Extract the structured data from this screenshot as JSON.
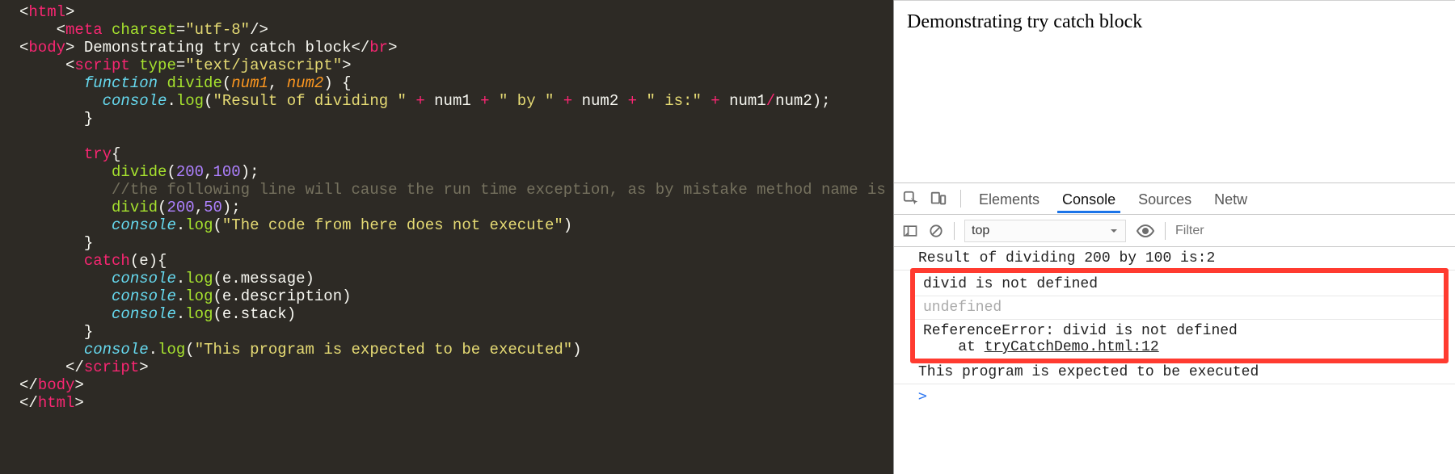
{
  "code": {
    "l1": {
      "a": "<",
      "b": "html",
      "c": ">"
    },
    "l2": {
      "a": "    <",
      "b": "meta",
      "sp": " ",
      "attr": "charset",
      "eq": "=",
      "str": "\"utf-8\"",
      "end": "/>"
    },
    "l3": {
      "a": "<",
      "b": "body",
      "c": "> Demonstrating try catch block</",
      "d": "br",
      "e": ">"
    },
    "l4": {
      "a": "     <",
      "b": "script",
      "sp": " ",
      "attr": "type",
      "eq": "=",
      "str": "\"text/javascript\"",
      "end": ">"
    },
    "l5": {
      "ind": "       ",
      "kw": "function",
      "sp": " ",
      "fn": "divide",
      "p1": "(",
      "a1": "num1",
      "cm": ", ",
      "a2": "num2",
      "p2": ") {"
    },
    "l6": {
      "ind": "         ",
      "obj": "console",
      "dot": ".",
      "m": "log",
      "p": "(",
      "s1": "\"Result of dividing \"",
      "op1": " + ",
      "v1": "num1",
      "op2": " + ",
      "s2": "\" by \"",
      "op3": " + ",
      "v2": "num2",
      "op4": " + ",
      "s3": "\" is:\"",
      "op5": " + ",
      "v3": "num1",
      "slash": "/",
      "v4": "num2",
      "end": ");"
    },
    "l7": {
      "ind": "       ",
      "c": "}"
    },
    "l8": "",
    "l9": {
      "ind": "       ",
      "kw": "try",
      "c": "{"
    },
    "l10": {
      "ind": "          ",
      "fn": "divide",
      "p": "(",
      "n1": "200",
      "cm": ",",
      "n2": "100",
      "end": ");"
    },
    "l11": {
      "ind": "          ",
      "cmt": "//the following line will cause the run time exception, as by mistake method name is wrong"
    },
    "l12": {
      "ind": "          ",
      "fn": "divid",
      "p": "(",
      "n1": "200",
      "cm": ",",
      "n2": "50",
      "end": ");"
    },
    "l13": {
      "ind": "          ",
      "obj": "console",
      "dot": ".",
      "m": "log",
      "p": "(",
      "s": "\"The code from here does not execute\"",
      "end": ")"
    },
    "l14": {
      "ind": "       ",
      "c": "}"
    },
    "l15": {
      "ind": "       ",
      "kw": "catch",
      "p": "(e){"
    },
    "l16": {
      "ind": "          ",
      "obj": "console",
      "dot": ".",
      "m": "log",
      "txt": "(e.message)"
    },
    "l17": {
      "ind": "          ",
      "obj": "console",
      "dot": ".",
      "m": "log",
      "txt": "(e.description)"
    },
    "l18": {
      "ind": "          ",
      "obj": "console",
      "dot": ".",
      "m": "log",
      "txt": "(e.stack)"
    },
    "l19": {
      "ind": "       ",
      "c": "}"
    },
    "l20": {
      "ind": "       ",
      "obj": "console",
      "dot": ".",
      "m": "log",
      "p": "(",
      "s": "\"This program is expected to be executed\"",
      "end": ")"
    },
    "l21": {
      "a": "     </",
      "b": "script",
      "c": ">"
    },
    "l22": {
      "a": "</",
      "b": "body",
      "c": ">"
    },
    "l23": {
      "a": "</",
      "b": "html",
      "c": ">"
    }
  },
  "page": {
    "title": "Demonstrating try catch block"
  },
  "devtools": {
    "tabs": {
      "elements": "Elements",
      "console": "Console",
      "sources": "Sources",
      "network": "Netw"
    },
    "context": "top",
    "filter_placeholder": "Filter",
    "log": {
      "line1": "Result of dividing 200 by 100 is:2",
      "line2": "divid is not defined",
      "line3": "undefined",
      "line4a": "ReferenceError: divid is not defined",
      "line4b": "    at ",
      "line4c": "tryCatchDemo.html:12",
      "line5": "This program is expected to be executed"
    },
    "prompt": ">"
  }
}
